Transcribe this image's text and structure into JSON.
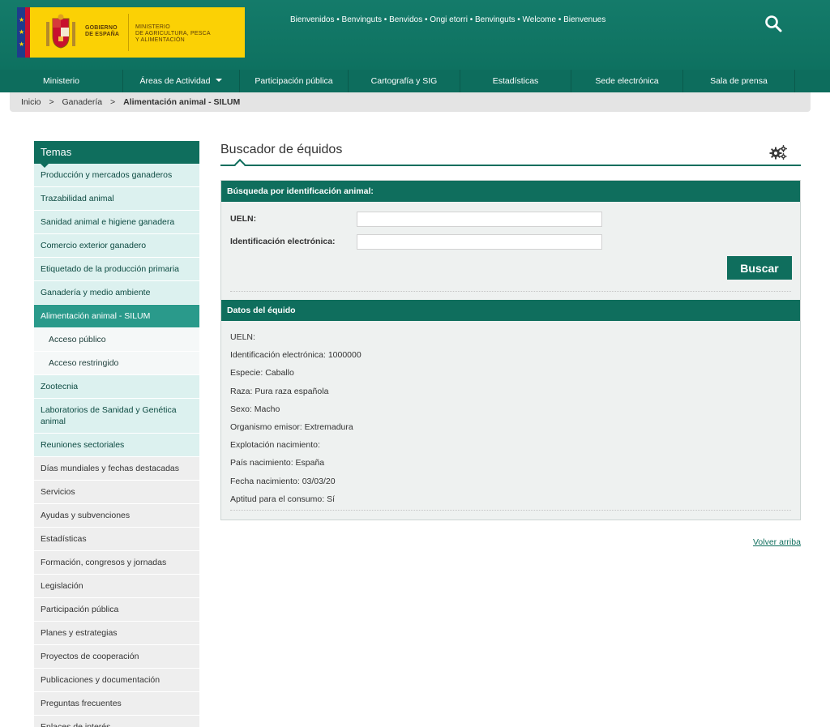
{
  "header": {
    "gobierno_line1": "GOBIERNO",
    "gobierno_line2": "DE ESPAÑA",
    "ministerio_line1": "MINISTERIO",
    "ministerio_line2": "DE AGRICULTURA, PESCA",
    "ministerio_line3": "Y ALIMENTACIÓN",
    "welcome": "Bienvenidos • Benvinguts • Benvidos • Ongi etorri • Benvinguts • Welcome • Bienvenues",
    "search_icon": "search-icon"
  },
  "nav": [
    {
      "label": "Ministerio"
    },
    {
      "label": "Áreas de Actividad"
    },
    {
      "label": "Participación pública"
    },
    {
      "label": "Cartografía y SIG"
    },
    {
      "label": "Estadísticas"
    },
    {
      "label": "Sede electrónica"
    },
    {
      "label": "Sala de prensa"
    }
  ],
  "breadcrumb": {
    "items": [
      "Inicio",
      "Ganadería",
      "Alimentación animal - SILUM"
    ],
    "sep": ">"
  },
  "sidebar": {
    "title": "Temas",
    "items": [
      {
        "label": "Producción y mercados ganaderos"
      },
      {
        "label": "Trazabilidad animal"
      },
      {
        "label": "Sanidad animal e higiene ganadera"
      },
      {
        "label": "Comercio exterior ganadero"
      },
      {
        "label": "Etiquetado de la producción primaria"
      },
      {
        "label": "Ganadería y medio ambiente"
      },
      {
        "label": "Alimentación animal - SILUM"
      },
      {
        "label": "Acceso público"
      },
      {
        "label": "Acceso restringido"
      },
      {
        "label": "Zootecnia"
      },
      {
        "label": "Laboratorios de Sanidad y Genética animal"
      },
      {
        "label": "Reuniones sectoriales"
      },
      {
        "label": "Días mundiales y fechas destacadas"
      },
      {
        "label": "Servicios"
      },
      {
        "label": "Ayudas y subvenciones"
      },
      {
        "label": "Estadísticas"
      },
      {
        "label": "Formación, congresos y jornadas"
      },
      {
        "label": "Legislación"
      },
      {
        "label": "Participación pública"
      },
      {
        "label": "Planes y estrategias"
      },
      {
        "label": "Proyectos de cooperación"
      },
      {
        "label": "Publicaciones y documentación"
      },
      {
        "label": "Preguntas frecuentes"
      },
      {
        "label": "Enlaces de interés"
      }
    ]
  },
  "main": {
    "title": "Buscador de équidos",
    "settings_icon": "gears-icon",
    "search_panel": {
      "title": "Búsqueda por identificación animal:",
      "ueln_label": "UELN:",
      "ueln_value": "",
      "id_label": "Identificación electrónica:",
      "id_value": "",
      "button": "Buscar"
    },
    "datos": {
      "title": "Datos del équido",
      "rows": [
        "UELN:",
        "Identificación electrónica: 1000000",
        "Especie: Caballo",
        "Raza: Pura raza española",
        "Sexo: Macho",
        "Organismo emisor: Extremadura",
        "Explotación nacimiento:",
        "País nacimiento: España",
        "Fecha nacimiento: 03/03/20",
        "Aptitud para el consumo: Sí"
      ]
    },
    "volver": "Volver arriba"
  },
  "colors": {
    "primary": "#0f6e5d",
    "highlight": "#dcf1ef",
    "active": "#2a9a8b",
    "logo_yellow": "#fbd105"
  }
}
